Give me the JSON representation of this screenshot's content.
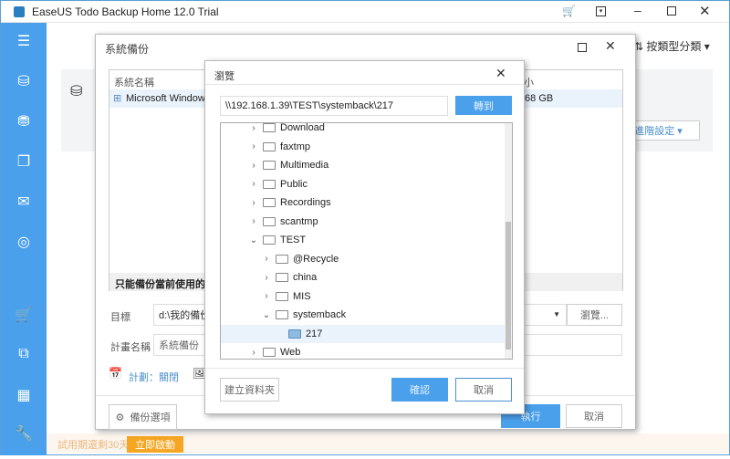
{
  "app": {
    "title": "EaseUS Todo Backup Home 12.0 Trial",
    "sort_label": "按類型分類",
    "advanced_label": "進階設定",
    "trial_text": "試用期還剩30天",
    "activate_label": "立即啟動"
  },
  "backup_dialog": {
    "title": "系統備份",
    "col_name": "系統名稱",
    "col_size": "小",
    "row_name": "Microsoft Windows",
    "row_size": ".68 GB",
    "note": "只能備份當前使用的系統",
    "target_label": "目標",
    "target_value": "d:\\我的備份",
    "browse_label": "瀏覽...",
    "plan_label": "計畫名稱",
    "plan_value": "系統備份",
    "schedule_label": "計劃：關閉",
    "options_label": "備份選項",
    "execute_label": "執行",
    "cancel_label": "取消"
  },
  "browse_dialog": {
    "title": "瀏覽",
    "path": "\\\\192.168.1.39\\TEST\\systemback\\217",
    "goto_label": "轉到",
    "new_folder_label": "建立資料夾",
    "ok_label": "確認",
    "cancel_label": "取消",
    "tree": [
      {
        "label": "Download",
        "level": 1,
        "state": "collapsed"
      },
      {
        "label": "faxtmp",
        "level": 1,
        "state": "collapsed"
      },
      {
        "label": "Multimedia",
        "level": 1,
        "state": "collapsed"
      },
      {
        "label": "Public",
        "level": 1,
        "state": "collapsed"
      },
      {
        "label": "Recordings",
        "level": 1,
        "state": "collapsed"
      },
      {
        "label": "scantmp",
        "level": 1,
        "state": "collapsed"
      },
      {
        "label": "TEST",
        "level": 1,
        "state": "expanded"
      },
      {
        "label": "@Recycle",
        "level": 2,
        "state": "collapsed"
      },
      {
        "label": "china",
        "level": 2,
        "state": "collapsed"
      },
      {
        "label": "MIS",
        "level": 2,
        "state": "collapsed"
      },
      {
        "label": "systemback",
        "level": 2,
        "state": "expanded"
      },
      {
        "label": "217",
        "level": 3,
        "state": "leaf",
        "selected": true
      },
      {
        "label": "Web",
        "level": 1,
        "state": "collapsed"
      }
    ]
  },
  "colors": {
    "accent": "#4aa0ea",
    "trial": "#f5a623"
  }
}
